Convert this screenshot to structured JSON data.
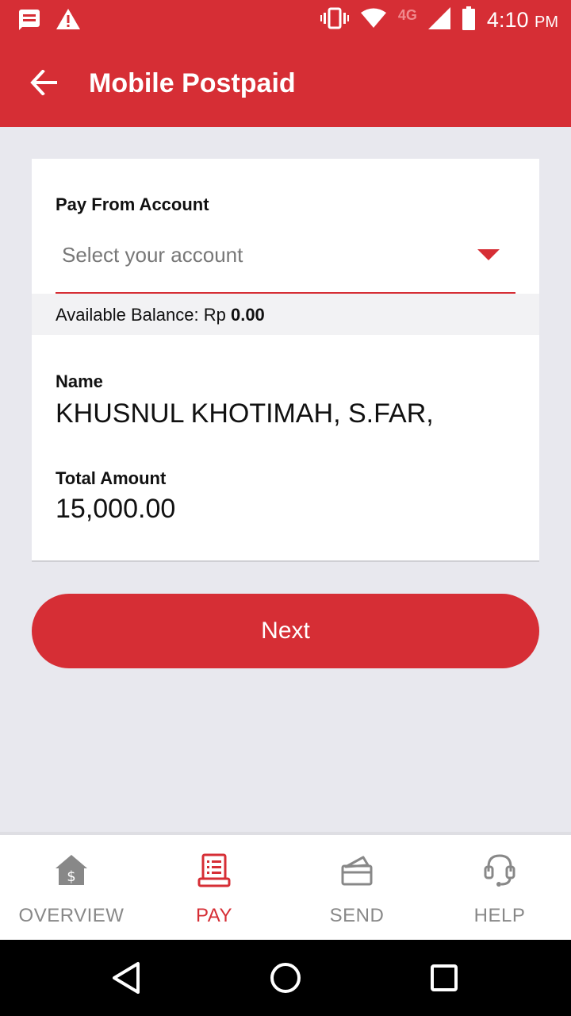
{
  "status_bar": {
    "time": "4:10",
    "time_suffix": "PM",
    "network": "4G",
    "icons": [
      "notification-icon",
      "warning-icon",
      "vibrate-icon",
      "wifi-icon",
      "signal-icon",
      "battery-icon"
    ]
  },
  "app_bar": {
    "title": "Mobile Postpaid",
    "back_icon": "arrow-left-icon"
  },
  "form": {
    "pay_from_label": "Pay From Account",
    "account_placeholder": "Select your account",
    "balance_label": "Available Balance: Rp",
    "balance_value": "0.00",
    "name_label": "Name",
    "name_value": "KHUSNUL KHOTIMAH, S.FAR,",
    "amount_label": "Total Amount",
    "amount_value": "15,000.00"
  },
  "next_button": "Next",
  "bottom_nav": {
    "items": [
      {
        "label": "OVERVIEW",
        "icon": "house-dollar-icon",
        "active": false
      },
      {
        "label": "PAY",
        "icon": "receipt-icon",
        "active": true
      },
      {
        "label": "SEND",
        "icon": "wallet-icon",
        "active": false
      },
      {
        "label": "HELP",
        "icon": "headset-icon",
        "active": false
      }
    ]
  },
  "colors": {
    "brand": "#d62e35",
    "background": "#e8e8ee",
    "inactive": "#888888"
  }
}
